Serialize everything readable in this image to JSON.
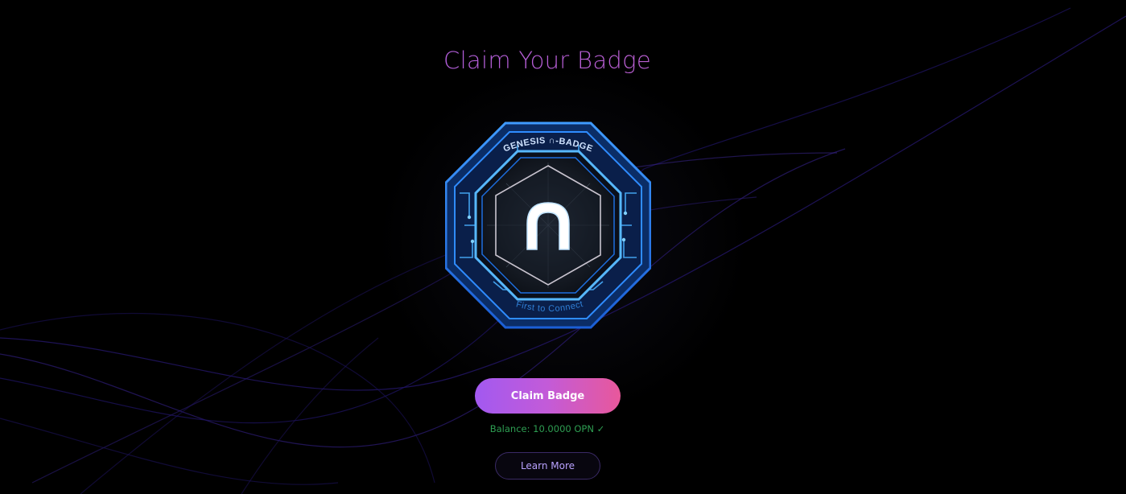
{
  "page": {
    "title": "Claim Your Badge"
  },
  "badge": {
    "top_text": "GENESIS ∩-BADGE",
    "bottom_text": "First to Connect",
    "center_glyph": "n"
  },
  "actions": {
    "claim_label": "Claim Badge",
    "learn_more_label": "Learn More"
  },
  "status": {
    "balance_text": "Balance: 10.0000 OPN ✓"
  },
  "colors": {
    "title_gradient_start": "#9e5ae6",
    "title_gradient_end": "#d063c7",
    "claim_gradient_start": "#a259f0",
    "claim_gradient_end": "#e8589b",
    "balance_text": "#2e9e52",
    "learn_more_border": "#3a2a66",
    "badge_glow": "#2a8cff"
  }
}
